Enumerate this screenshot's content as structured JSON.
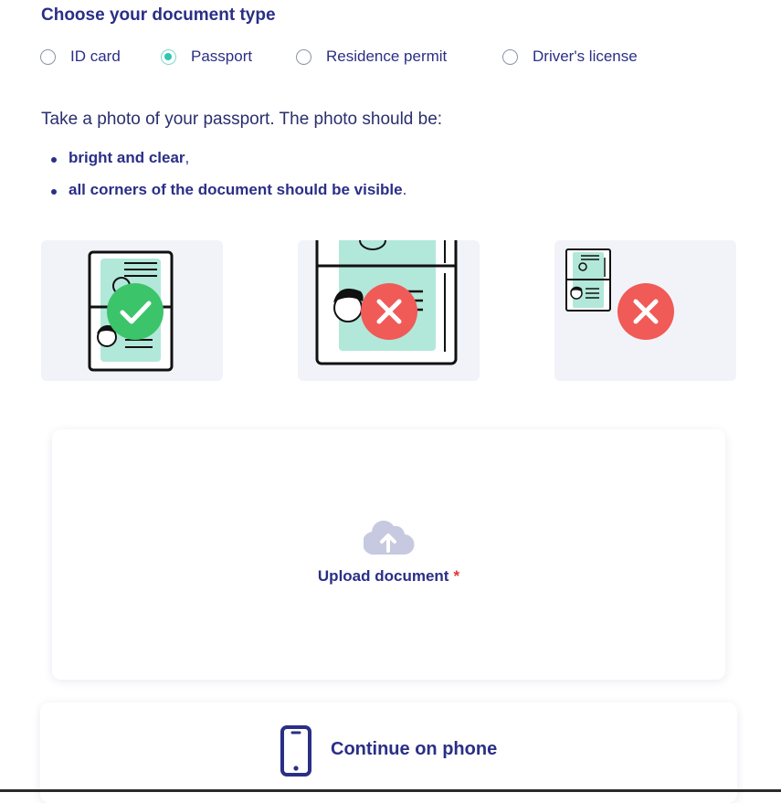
{
  "heading": "Choose your document type",
  "document_types": [
    {
      "label": "ID card",
      "selected": false
    },
    {
      "label": "Passport",
      "selected": true
    },
    {
      "label": "Residence permit",
      "selected": false
    },
    {
      "label": "Driver's license",
      "selected": false
    }
  ],
  "instructions": {
    "intro": "Take a photo of your passport. The photo should be:",
    "bullets": [
      {
        "bold": "bright and clear",
        "suffix": ","
      },
      {
        "bold": "all corners of the document should be visible",
        "suffix": "."
      }
    ]
  },
  "examples": [
    {
      "verdict": "correct",
      "icon": "check-icon"
    },
    {
      "verdict": "incorrect",
      "icon": "cross-icon"
    },
    {
      "verdict": "incorrect",
      "icon": "cross-icon"
    }
  ],
  "upload": {
    "label": "Upload document",
    "required_mark": "*",
    "icon": "cloud-upload-icon"
  },
  "phone": {
    "label": "Continue on phone",
    "icon": "smartphone-icon"
  },
  "colors": {
    "primary": "#2a2f86",
    "accent": "#2ec7b1",
    "success": "#3cc46b",
    "error": "#f05a57",
    "illustration_mint": "#b2e8d9",
    "example_bg": "#f2f3f8",
    "upload_icon": "#c6c9e0"
  }
}
